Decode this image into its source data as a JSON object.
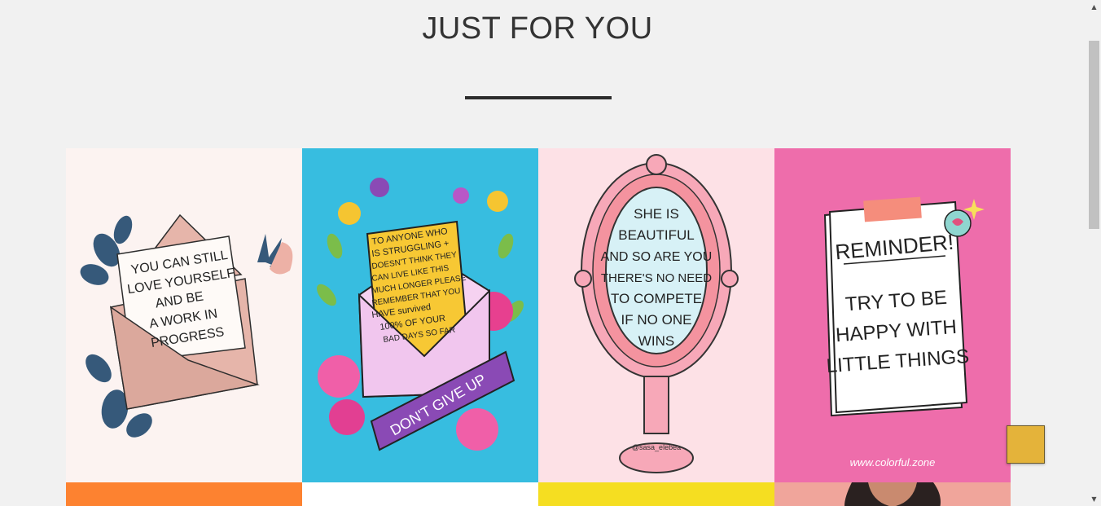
{
  "section": {
    "title": "JUST FOR YOU"
  },
  "cards": [
    {
      "lines": [
        "YOU CAN STILL",
        "LOVE YOURSELF",
        "AND BE",
        "A WORK IN",
        "PROGRESS"
      ],
      "bg": "#fcf3f1"
    },
    {
      "lines": [
        "TO ANYONE WHO",
        "IS STRUGGLING +",
        "DOESN'T THINK THEY",
        "CAN LIVE LIKE THIS",
        "MUCH LONGER PLEASE",
        "REMEMBER THAT YOU",
        "HAVE survived",
        "100% OF YOUR",
        "BAD DAYS SO FAR"
      ],
      "banner": "DON'T GIVE UP",
      "bg": "#37bde0"
    },
    {
      "lines": [
        "SHE IS",
        "BEAUTIFUL",
        "AND SO ARE YOU",
        "THERE'S NO NEED",
        "TO COMPETE",
        "IF NO ONE",
        "WINS"
      ],
      "credit": "@sasa_elebea",
      "bg": "#fde1e6"
    },
    {
      "heading": "REMINDER!",
      "lines": [
        "TRY TO BE",
        "HAPPY WITH",
        "LITTLE THINGS"
      ],
      "credit": "www.colorful.zone",
      "bg": "#ee6dab"
    }
  ],
  "row2_colors": [
    "#fd8230",
    "#ffffff",
    "#f5de21",
    "#f0a59b"
  ],
  "back_to_top": {
    "icon": "arrow-up-icon",
    "glyph": ""
  },
  "scrollbar": {
    "up": "▲",
    "down": "▼"
  }
}
